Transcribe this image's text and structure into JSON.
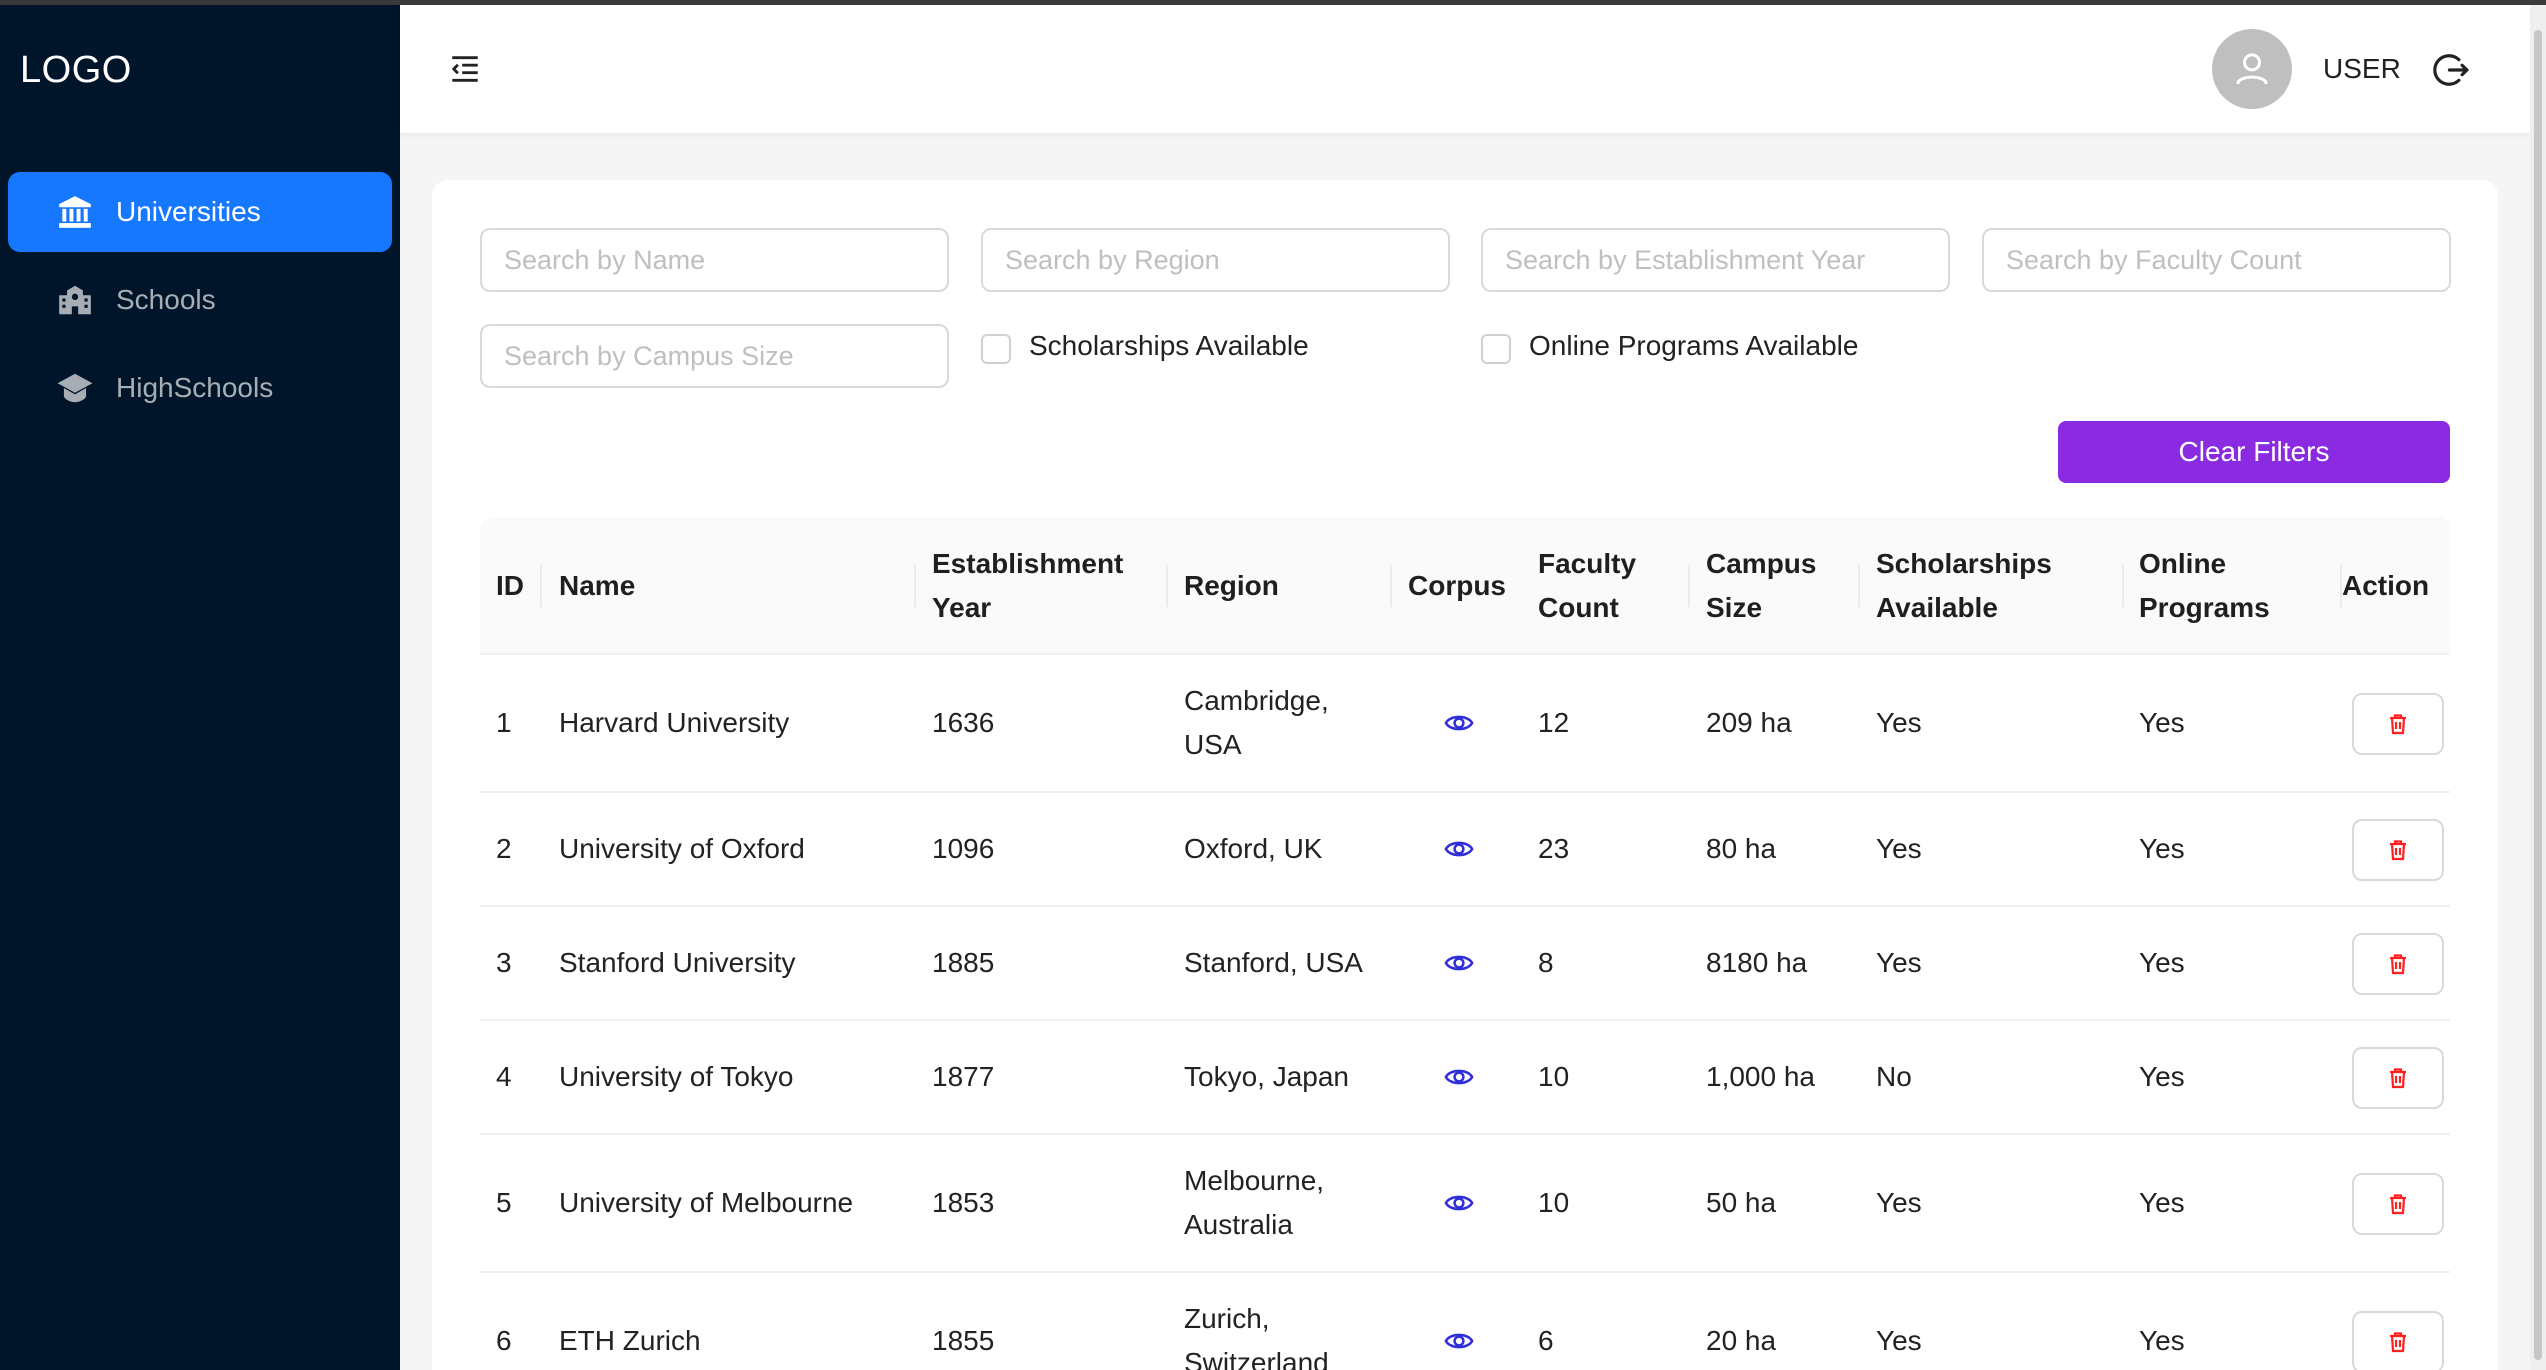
{
  "sidebar": {
    "logo": "LOGO",
    "items": [
      {
        "label": "Universities",
        "icon": "bank-icon",
        "active": true
      },
      {
        "label": "Schools",
        "icon": "school-building-icon",
        "active": false
      },
      {
        "label": "HighSchools",
        "icon": "graduation-cap-icon",
        "active": false
      }
    ]
  },
  "header": {
    "user_label": "USER",
    "menu_icon": "menu-fold-icon",
    "avatar_icon": "user-icon",
    "logout_icon": "logout-icon"
  },
  "filters": {
    "name_placeholder": "Search by Name",
    "region_placeholder": "Search by Region",
    "year_placeholder": "Search by Establishment Year",
    "faculty_placeholder": "Search by Faculty Count",
    "campus_placeholder": "Search by Campus Size",
    "scholarships_label": "Scholarships Available",
    "online_label": "Online Programs Available",
    "clear_label": "Clear Filters"
  },
  "table": {
    "headers": {
      "id": "ID",
      "name": "Name",
      "year": [
        "Establishment",
        "Year"
      ],
      "region": "Region",
      "corpus": "Corpus",
      "faculty": [
        "Faculty",
        "Count"
      ],
      "campus": [
        "Campus",
        "Size"
      ],
      "scholarships": [
        "Scholarships",
        "Available"
      ],
      "online": [
        "Online",
        "Programs"
      ],
      "action": "Action"
    },
    "rows": [
      {
        "id": "1",
        "name": "Harvard University",
        "year": "1636",
        "region": [
          "Cambridge,",
          "USA"
        ],
        "faculty": "12",
        "campus": "209 ha",
        "scholarships": "Yes",
        "online": "Yes"
      },
      {
        "id": "2",
        "name": "University of Oxford",
        "year": "1096",
        "region": [
          "Oxford, UK"
        ],
        "faculty": "23",
        "campus": "80 ha",
        "scholarships": "Yes",
        "online": "Yes"
      },
      {
        "id": "3",
        "name": "Stanford University",
        "year": "1885",
        "region": [
          "Stanford, USA"
        ],
        "faculty": "8",
        "campus": "8180 ha",
        "scholarships": "Yes",
        "online": "Yes"
      },
      {
        "id": "4",
        "name": "University of Tokyo",
        "year": "1877",
        "region": [
          "Tokyo, Japan"
        ],
        "faculty": "10",
        "campus": "1,000 ha",
        "scholarships": "No",
        "online": "Yes"
      },
      {
        "id": "5",
        "name": "University of Melbourne",
        "year": "1853",
        "region": [
          "Melbourne,",
          "Australia"
        ],
        "faculty": "10",
        "campus": "50 ha",
        "scholarships": "Yes",
        "online": "Yes"
      },
      {
        "id": "6",
        "name": "ETH Zurich",
        "year": "1855",
        "region": [
          "Zurich,",
          "Switzerland"
        ],
        "faculty": "6",
        "campus": "20 ha",
        "scholarships": "Yes",
        "online": "Yes"
      }
    ]
  },
  "colors": {
    "sidebar_bg": "#001529",
    "active_item": "#1677ff",
    "clear_button": "#8a2be2",
    "corpus_icon": "#2f2fd8",
    "delete_icon": "#ff1f1f"
  }
}
